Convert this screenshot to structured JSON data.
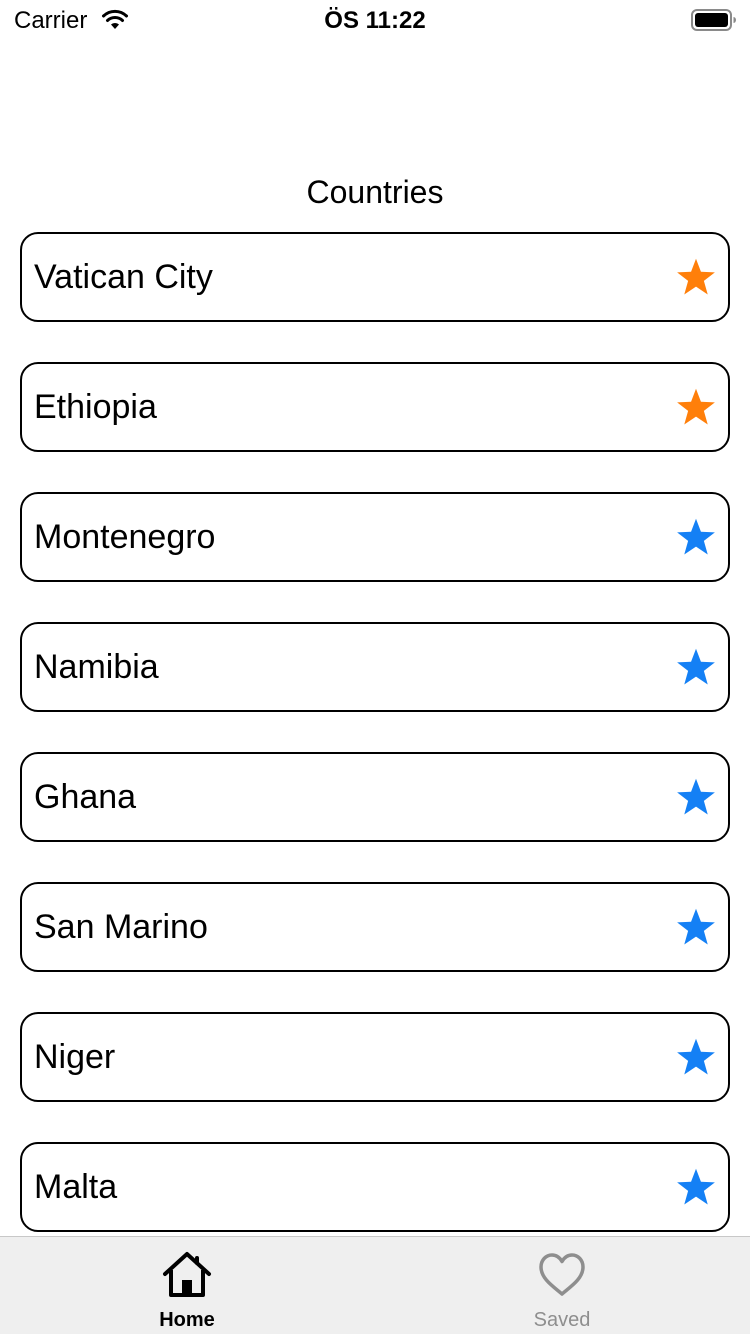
{
  "status_bar": {
    "carrier": "Carrier",
    "time": "ÖS 11:22"
  },
  "page_title": "Countries",
  "countries": [
    {
      "name": "Vatican City",
      "star_color": "#FF7F0A"
    },
    {
      "name": "Ethiopia",
      "star_color": "#FF7F0A"
    },
    {
      "name": "Montenegro",
      "star_color": "#1480F5"
    },
    {
      "name": "Namibia",
      "star_color": "#1480F5"
    },
    {
      "name": "Ghana",
      "star_color": "#1480F5"
    },
    {
      "name": "San Marino",
      "star_color": "#1480F5"
    },
    {
      "name": "Niger",
      "star_color": "#1480F5"
    },
    {
      "name": "Malta",
      "star_color": "#1480F5"
    }
  ],
  "tab_bar": {
    "home_label": "Home",
    "saved_label": "Saved",
    "home_icon": "house-icon",
    "saved_icon": "heart-icon"
  }
}
